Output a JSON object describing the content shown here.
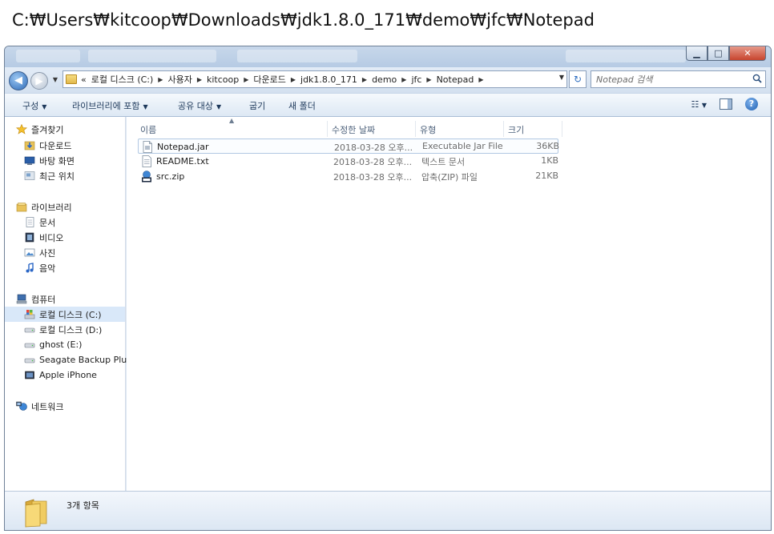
{
  "caption": "C:₩Users₩kitcoop₩Downloads₩jdk1.8.0_171₩demo₩jfc₩Notepad",
  "address": {
    "overflow": "«",
    "segments": [
      "로컬 디스크 (C:)",
      "사용자",
      "kitcoop",
      "다운로드",
      "jdk1.8.0_171",
      "demo",
      "jfc",
      "Notepad"
    ]
  },
  "search": {
    "placeholder": "Notepad 검색"
  },
  "toolbar": {
    "organize": "구성",
    "include_in_library": "라이브러리에 포함",
    "share_with": "공유 대상",
    "burn": "굽기",
    "new_folder": "새 폴더"
  },
  "navigation": {
    "favorites": {
      "label": "즐겨찾기",
      "items": [
        "다운로드",
        "바탕 화면",
        "최근 위치"
      ]
    },
    "libraries": {
      "label": "라이브러리",
      "items": [
        "문서",
        "비디오",
        "사진",
        "음악"
      ]
    },
    "computer": {
      "label": "컴퓨터",
      "items": [
        "로컬 디스크 (C:)",
        "로컬 디스크 (D:)",
        "ghost (E:)",
        "Seagate Backup Plu",
        "Apple iPhone"
      ]
    },
    "network": {
      "label": "네트워크"
    }
  },
  "columns": {
    "name": "이름",
    "modified": "수정한 날짜",
    "type": "유형",
    "size": "크기"
  },
  "files": [
    {
      "name": "Notepad.jar",
      "modified": "2018-03-28 오후...",
      "type": "Executable Jar File",
      "size": "36KB",
      "icon": "jar-file-icon"
    },
    {
      "name": "README.txt",
      "modified": "2018-03-28 오후...",
      "type": "텍스트 문서",
      "size": "1KB",
      "icon": "text-file-icon"
    },
    {
      "name": "src.zip",
      "modified": "2018-03-28 오후...",
      "type": "압축(ZIP) 파일",
      "size": "21KB",
      "icon": "zip-file-icon"
    }
  ],
  "status": {
    "item_count": "3개 항목"
  }
}
